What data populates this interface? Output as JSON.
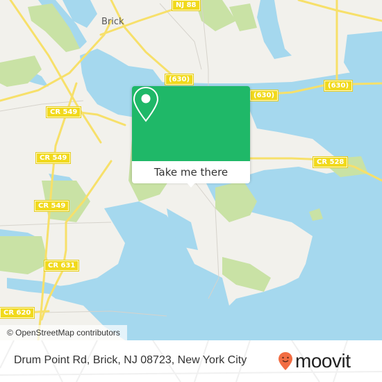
{
  "map": {
    "place_labels": [
      {
        "id": "brick",
        "text": "Brick"
      }
    ],
    "road_shields": [
      {
        "id": "nj88",
        "text": "NJ 88"
      },
      {
        "id": "630a",
        "text": "(630)"
      },
      {
        "id": "630b",
        "text": "(630)"
      },
      {
        "id": "630c",
        "text": "(630)"
      },
      {
        "id": "cr549a",
        "text": "CR 549"
      },
      {
        "id": "cr549b",
        "text": "CR 549"
      },
      {
        "id": "cr549c",
        "text": "CR 549"
      },
      {
        "id": "cr528",
        "text": "CR 528"
      },
      {
        "id": "cr631",
        "text": "CR 631"
      },
      {
        "id": "cr620",
        "text": "CR 620"
      }
    ],
    "colors": {
      "land": "#f2f1ec",
      "water": "#a5d8ee",
      "park": "#c9e2a5",
      "road": "#f7e06a",
      "accent": "#1fb868"
    },
    "attribution": "© OpenStreetMap contributors"
  },
  "popup": {
    "icon": "location-pin-icon",
    "action_label": "Take me there"
  },
  "footer": {
    "address": "Drum Point Rd, Brick, NJ 08723, New York City",
    "brand": "moovit",
    "brand_color": "#f26d43"
  }
}
